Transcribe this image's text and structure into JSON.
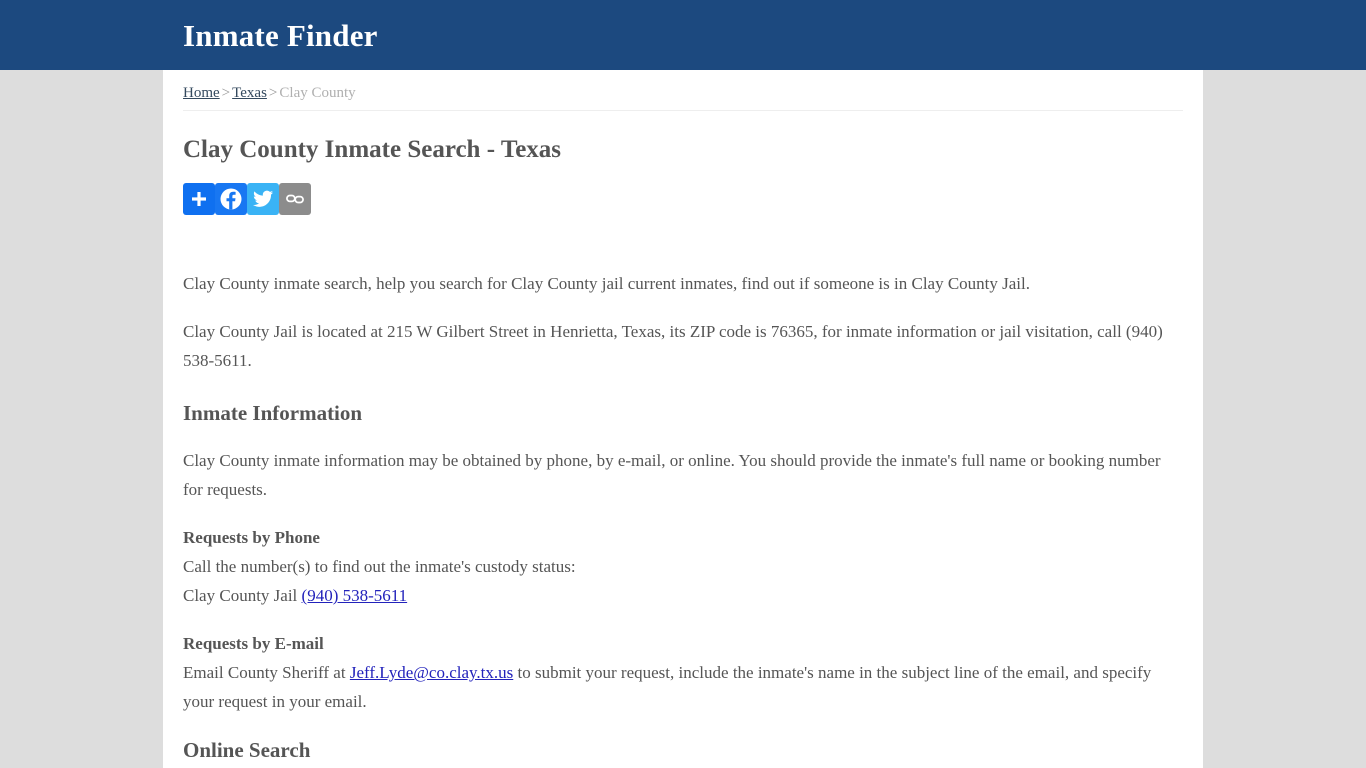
{
  "header": {
    "site_title": "Inmate Finder",
    "background_color": "#1c497f"
  },
  "breadcrumb": {
    "home_label": "Home",
    "state_label": "Texas",
    "separator": ">",
    "current_label": "Clay County"
  },
  "page": {
    "title": "Clay County Inmate Search - Texas"
  },
  "share": {
    "buttons": [
      {
        "name": "addthis-share-button",
        "label": "Share",
        "icon": "plus-icon",
        "color": "#0f70f0"
      },
      {
        "name": "facebook-share-button",
        "label": "Facebook",
        "icon": "facebook-icon",
        "color": "#1877f2"
      },
      {
        "name": "twitter-share-button",
        "label": "Twitter",
        "icon": "twitter-bird-icon",
        "color": "#3ab3f5"
      },
      {
        "name": "copy-link-button",
        "label": "Copy Link",
        "icon": "link-chain-icon",
        "color": "#8c8c8c"
      }
    ]
  },
  "content": {
    "intro_paragraph": "Clay County inmate search, help you search for Clay County jail current inmates, find out if someone is in Clay County Jail.",
    "location_paragraph": "Clay County Jail is located at 215 W Gilbert Street in Henrietta, Texas, its ZIP code is 76365, for inmate information or jail visitation, call (940) 538-5611.",
    "inmate_information_heading": "Inmate Information",
    "inmate_information_paragraph": "Clay County inmate information may be obtained by phone, by e-mail, or online. You should provide the inmate's full name or booking number for requests.",
    "requests_by_phone": {
      "heading": "Requests by Phone",
      "instruction": "Call the number(s) to find out the inmate's custody status:",
      "facility_label": "Clay County Jail",
      "phone_link": "(940) 538-5611"
    },
    "requests_by_email": {
      "heading": "Requests by E-mail",
      "text_before_link": "Email County Sheriff at ",
      "email_link": "Jeff.Lyde@co.clay.tx.us",
      "text_after_link": " to submit your request, include the inmate's name in the subject line of the email, and specify your request in your email."
    },
    "online_search_heading": "Online Search"
  }
}
